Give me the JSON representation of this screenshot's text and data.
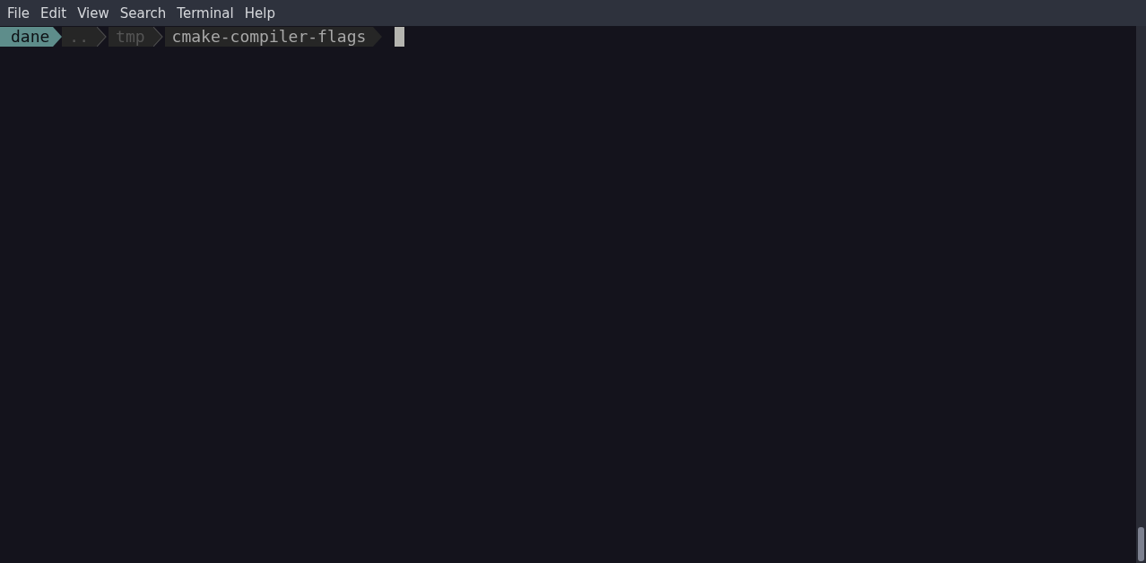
{
  "menu_bar": {
    "items": [
      {
        "label": "File"
      },
      {
        "label": "Edit"
      },
      {
        "label": "View"
      },
      {
        "label": "Search"
      },
      {
        "label": "Terminal"
      },
      {
        "label": "Help"
      }
    ]
  },
  "prompt": {
    "segments": [
      {
        "text": "dane",
        "kind": "user"
      },
      {
        "text": "..",
        "kind": "dim"
      },
      {
        "text": "tmp",
        "kind": "dim"
      },
      {
        "text": "cmake-compiler-flags",
        "kind": "current"
      }
    ]
  }
}
